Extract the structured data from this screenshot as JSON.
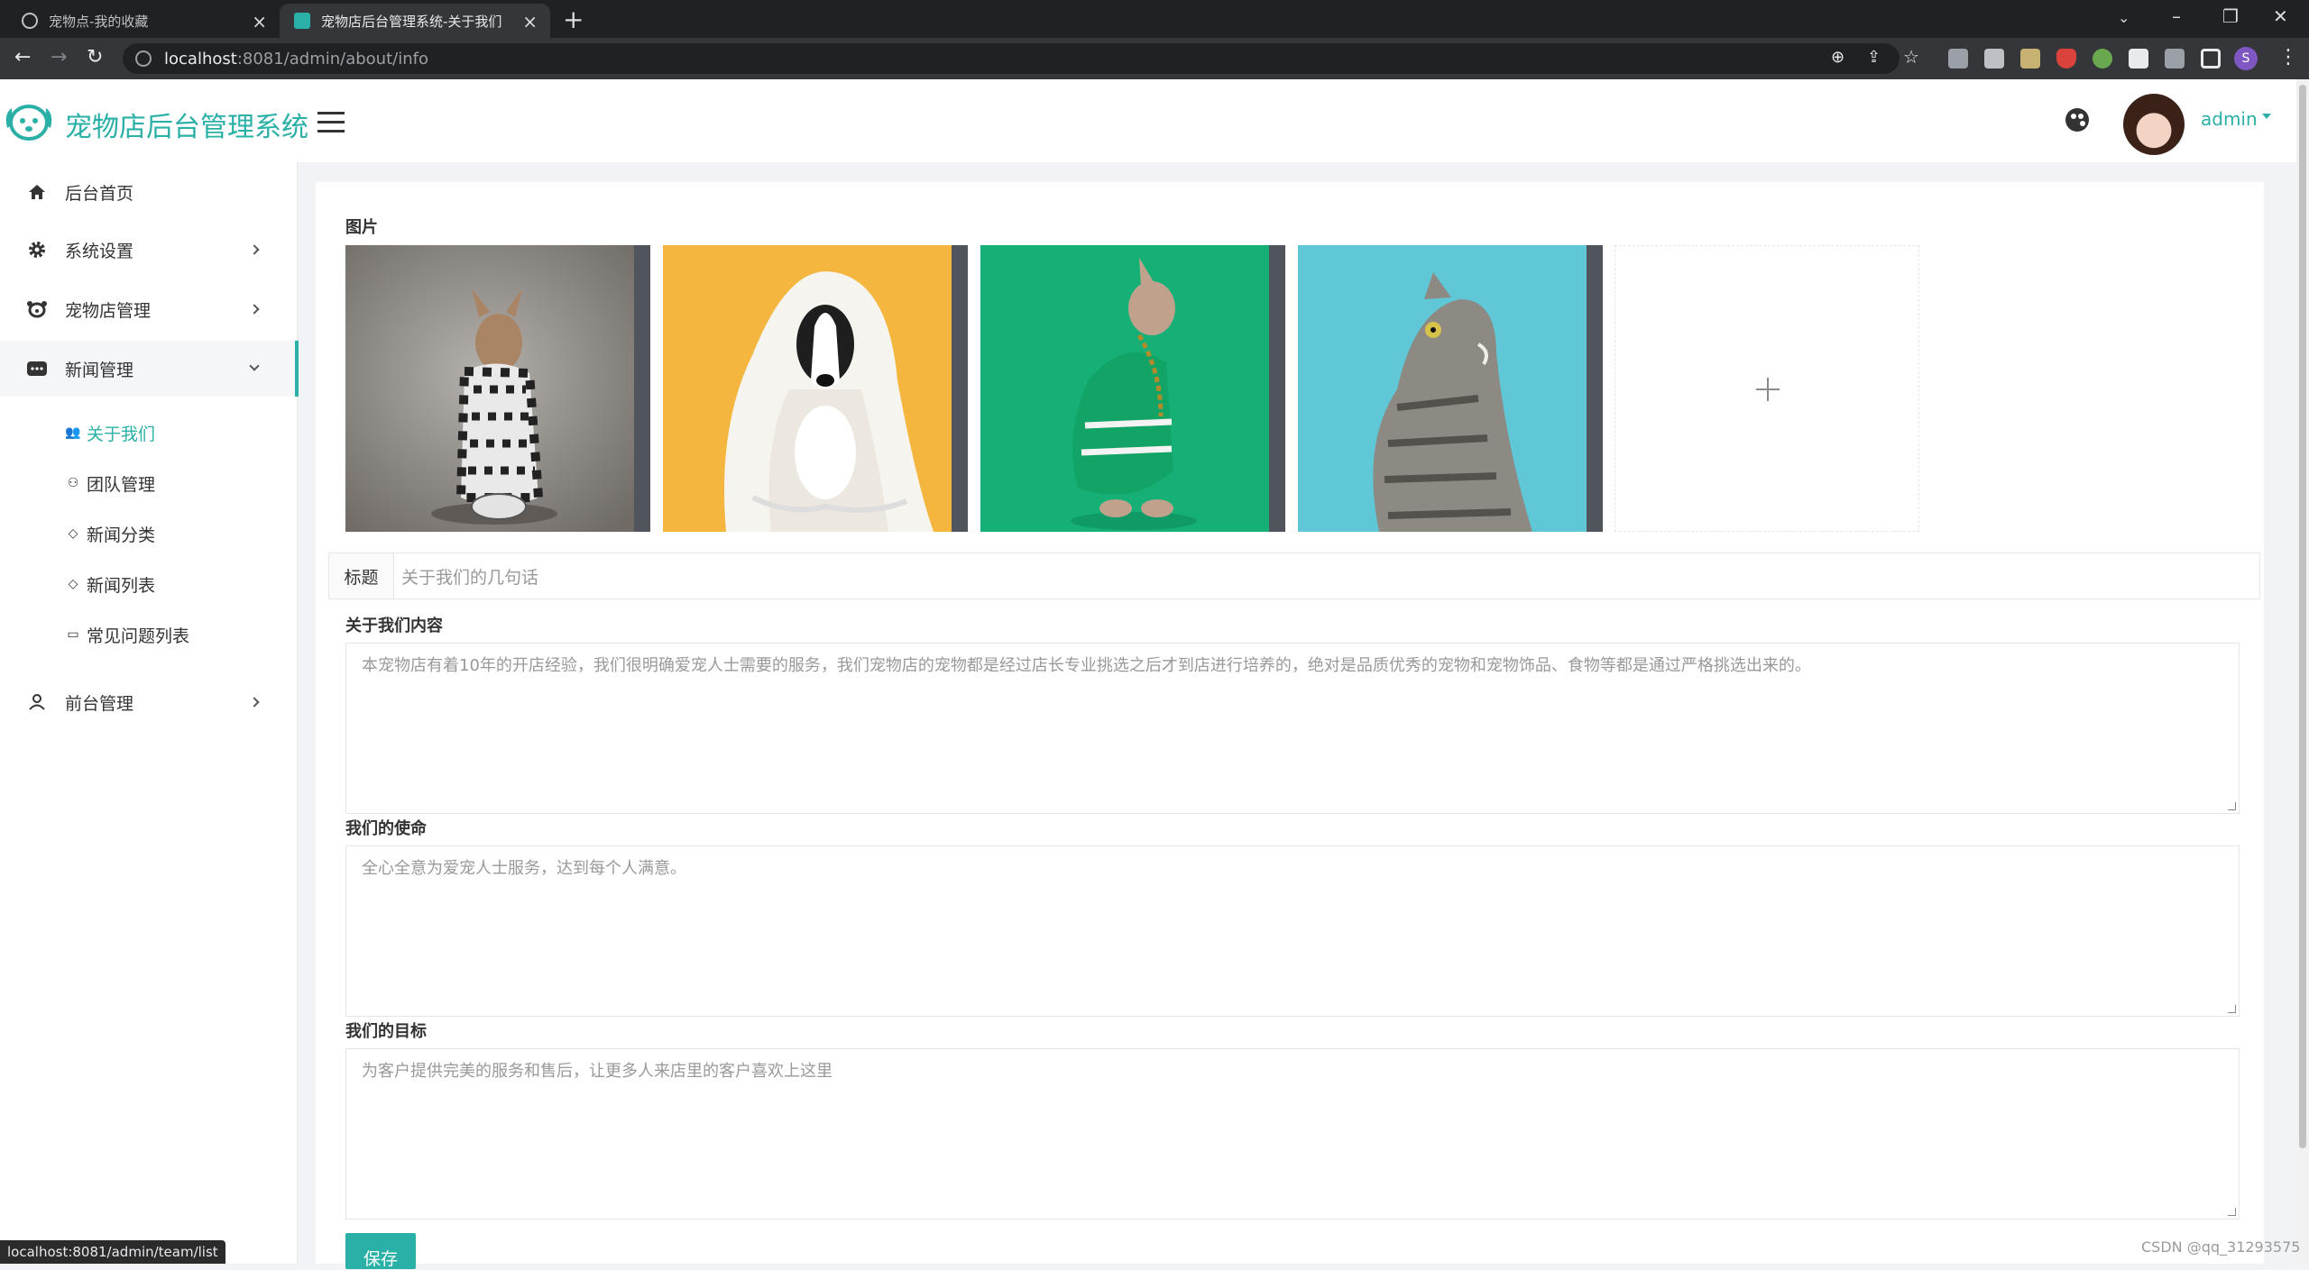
{
  "browser": {
    "tabs": [
      {
        "title": "宠物点-我的收藏",
        "active": false
      },
      {
        "title": "宠物店后台管理系统-关于我们",
        "active": true
      }
    ],
    "url_host": "localhost",
    "url_path": ":8081/admin/about/info",
    "profile_initial": "S"
  },
  "header": {
    "title": "宠物店后台管理系统",
    "user": "admin"
  },
  "sidebar": {
    "items": [
      {
        "label": "后台首页",
        "icon": "home-icon"
      },
      {
        "label": "系统设置",
        "icon": "gear-icon"
      },
      {
        "label": "宠物店管理",
        "icon": "pet-icon"
      },
      {
        "label": "新闻管理",
        "icon": "news-icon"
      },
      {
        "label": "前台管理",
        "icon": "user-icon"
      }
    ],
    "sub_items": [
      {
        "label": "关于我们",
        "active": true
      },
      {
        "label": "团队管理",
        "active": false
      },
      {
        "label": "新闻分类",
        "active": false
      },
      {
        "label": "新闻列表",
        "active": false
      },
      {
        "label": "常见问题列表",
        "active": false
      }
    ]
  },
  "form": {
    "images_label": "图片",
    "title_prefix": "标题",
    "title_value": "关于我们的几句话",
    "content_label": "关于我们内容",
    "content_value": "本宠物店有着10年的开店经验，我们很明确爱宠人士需要的服务，我们宠物店的宠物都是经过店长专业挑选之后才到店进行培养的，绝对是品质优秀的宠物和宠物饰品、食物等都是通过严格挑选出来的。",
    "mission_label": "我们的使命",
    "mission_value": "全心全意为爱宠人士服务，达到每个人满意。",
    "goal_label": "我们的目标",
    "goal_value": "为客户提供完美的服务和售后，让更多人来店里的客户喜欢上这里",
    "save_label": "保存"
  },
  "status_url": "localhost:8081/admin/team/list",
  "watermark": "CSDN @qq_31293575"
}
